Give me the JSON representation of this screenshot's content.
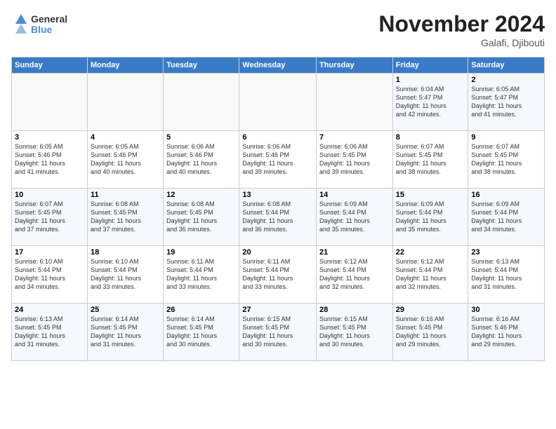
{
  "header": {
    "logo_line1": "General",
    "logo_line2": "Blue",
    "month": "November 2024",
    "location": "Galafi, Djibouti"
  },
  "weekdays": [
    "Sunday",
    "Monday",
    "Tuesday",
    "Wednesday",
    "Thursday",
    "Friday",
    "Saturday"
  ],
  "weeks": [
    [
      {
        "day": "",
        "info": ""
      },
      {
        "day": "",
        "info": ""
      },
      {
        "day": "",
        "info": ""
      },
      {
        "day": "",
        "info": ""
      },
      {
        "day": "",
        "info": ""
      },
      {
        "day": "1",
        "info": "Sunrise: 6:04 AM\nSunset: 5:47 PM\nDaylight: 11 hours\nand 42 minutes."
      },
      {
        "day": "2",
        "info": "Sunrise: 6:05 AM\nSunset: 5:47 PM\nDaylight: 11 hours\nand 41 minutes."
      }
    ],
    [
      {
        "day": "3",
        "info": "Sunrise: 6:05 AM\nSunset: 5:46 PM\nDaylight: 11 hours\nand 41 minutes."
      },
      {
        "day": "4",
        "info": "Sunrise: 6:05 AM\nSunset: 5:46 PM\nDaylight: 11 hours\nand 40 minutes."
      },
      {
        "day": "5",
        "info": "Sunrise: 6:06 AM\nSunset: 5:46 PM\nDaylight: 11 hours\nand 40 minutes."
      },
      {
        "day": "6",
        "info": "Sunrise: 6:06 AM\nSunset: 5:46 PM\nDaylight: 11 hours\nand 39 minutes."
      },
      {
        "day": "7",
        "info": "Sunrise: 6:06 AM\nSunset: 5:45 PM\nDaylight: 11 hours\nand 39 minutes."
      },
      {
        "day": "8",
        "info": "Sunrise: 6:07 AM\nSunset: 5:45 PM\nDaylight: 11 hours\nand 38 minutes."
      },
      {
        "day": "9",
        "info": "Sunrise: 6:07 AM\nSunset: 5:45 PM\nDaylight: 11 hours\nand 38 minutes."
      }
    ],
    [
      {
        "day": "10",
        "info": "Sunrise: 6:07 AM\nSunset: 5:45 PM\nDaylight: 11 hours\nand 37 minutes."
      },
      {
        "day": "11",
        "info": "Sunrise: 6:08 AM\nSunset: 5:45 PM\nDaylight: 11 hours\nand 37 minutes."
      },
      {
        "day": "12",
        "info": "Sunrise: 6:08 AM\nSunset: 5:45 PM\nDaylight: 11 hours\nand 36 minutes."
      },
      {
        "day": "13",
        "info": "Sunrise: 6:08 AM\nSunset: 5:44 PM\nDaylight: 11 hours\nand 36 minutes."
      },
      {
        "day": "14",
        "info": "Sunrise: 6:09 AM\nSunset: 5:44 PM\nDaylight: 11 hours\nand 35 minutes."
      },
      {
        "day": "15",
        "info": "Sunrise: 6:09 AM\nSunset: 5:44 PM\nDaylight: 11 hours\nand 35 minutes."
      },
      {
        "day": "16",
        "info": "Sunrise: 6:09 AM\nSunset: 5:44 PM\nDaylight: 11 hours\nand 34 minutes."
      }
    ],
    [
      {
        "day": "17",
        "info": "Sunrise: 6:10 AM\nSunset: 5:44 PM\nDaylight: 11 hours\nand 34 minutes."
      },
      {
        "day": "18",
        "info": "Sunrise: 6:10 AM\nSunset: 5:44 PM\nDaylight: 11 hours\nand 33 minutes."
      },
      {
        "day": "19",
        "info": "Sunrise: 6:11 AM\nSunset: 5:44 PM\nDaylight: 11 hours\nand 33 minutes."
      },
      {
        "day": "20",
        "info": "Sunrise: 6:11 AM\nSunset: 5:44 PM\nDaylight: 11 hours\nand 33 minutes."
      },
      {
        "day": "21",
        "info": "Sunrise: 6:12 AM\nSunset: 5:44 PM\nDaylight: 11 hours\nand 32 minutes."
      },
      {
        "day": "22",
        "info": "Sunrise: 6:12 AM\nSunset: 5:44 PM\nDaylight: 11 hours\nand 32 minutes."
      },
      {
        "day": "23",
        "info": "Sunrise: 6:13 AM\nSunset: 5:44 PM\nDaylight: 11 hours\nand 31 minutes."
      }
    ],
    [
      {
        "day": "24",
        "info": "Sunrise: 6:13 AM\nSunset: 5:45 PM\nDaylight: 11 hours\nand 31 minutes."
      },
      {
        "day": "25",
        "info": "Sunrise: 6:14 AM\nSunset: 5:45 PM\nDaylight: 11 hours\nand 31 minutes."
      },
      {
        "day": "26",
        "info": "Sunrise: 6:14 AM\nSunset: 5:45 PM\nDaylight: 11 hours\nand 30 minutes."
      },
      {
        "day": "27",
        "info": "Sunrise: 6:15 AM\nSunset: 5:45 PM\nDaylight: 11 hours\nand 30 minutes."
      },
      {
        "day": "28",
        "info": "Sunrise: 6:15 AM\nSunset: 5:45 PM\nDaylight: 11 hours\nand 30 minutes."
      },
      {
        "day": "29",
        "info": "Sunrise: 6:16 AM\nSunset: 5:45 PM\nDaylight: 11 hours\nand 29 minutes."
      },
      {
        "day": "30",
        "info": "Sunrise: 6:16 AM\nSunset: 5:46 PM\nDaylight: 11 hours\nand 29 minutes."
      }
    ]
  ]
}
